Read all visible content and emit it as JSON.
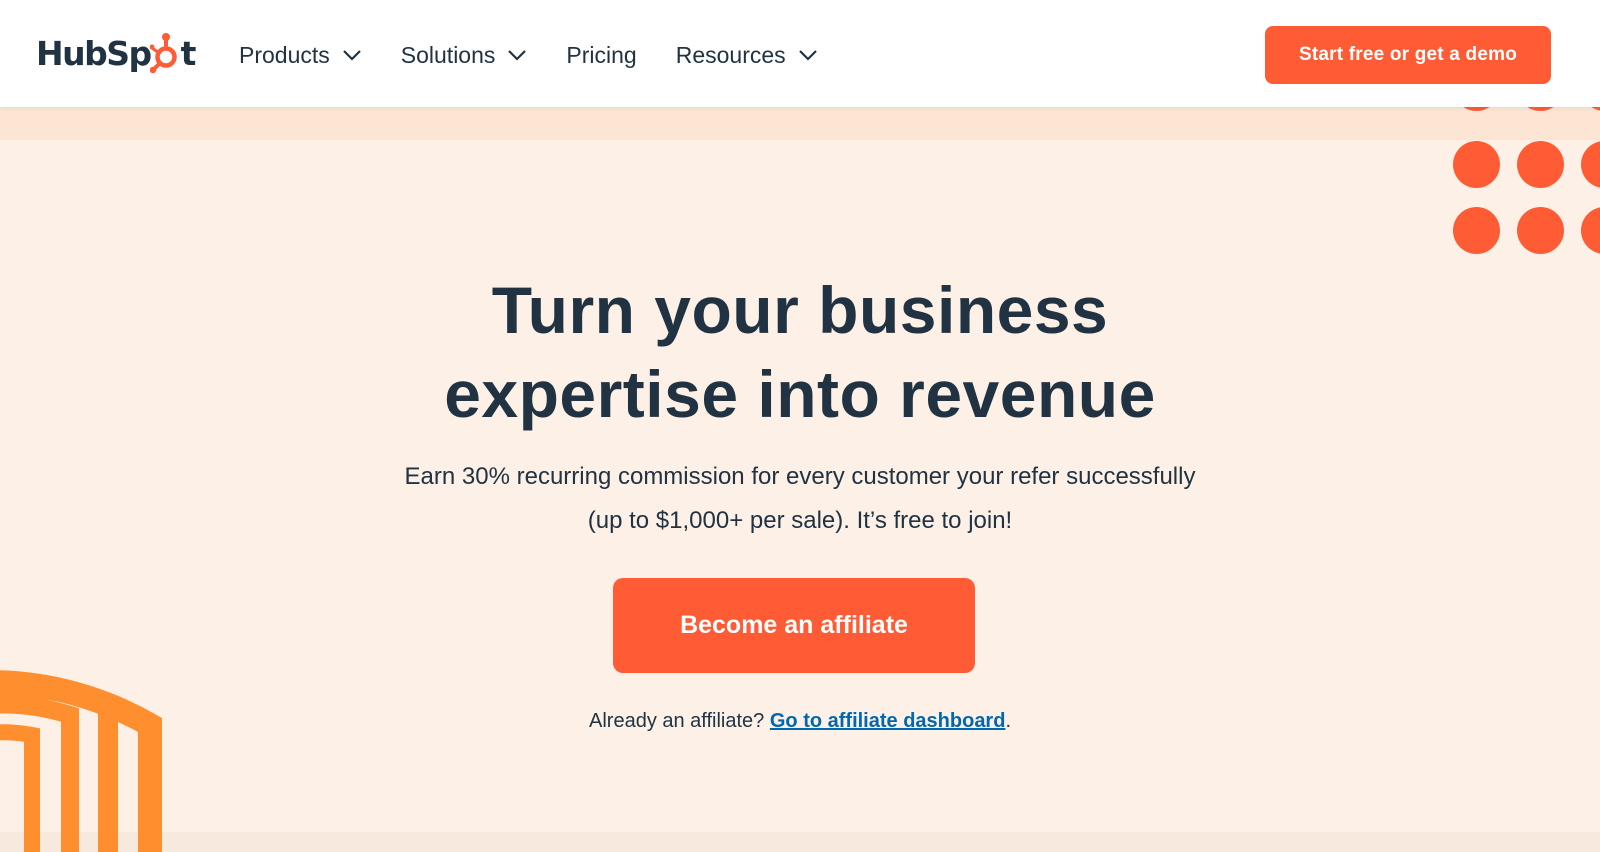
{
  "brand": {
    "logo_text_left": "HubSp",
    "logo_text_right": "t",
    "accent_color": "#ff5c35",
    "dark_color": "#213343",
    "link_color": "#0068b1",
    "background_color": "#fcf0e7",
    "arch_color": "#ff8f2e"
  },
  "nav": {
    "items": [
      {
        "label": "Products",
        "has_dropdown": true
      },
      {
        "label": "Solutions",
        "has_dropdown": true
      },
      {
        "label": "Pricing",
        "has_dropdown": false
      },
      {
        "label": "Resources",
        "has_dropdown": true
      }
    ],
    "cta_label": "Start free or get a demo"
  },
  "hero": {
    "title_line1": "Turn your business",
    "title_line2": "expertise into revenue",
    "subtitle_line1": "Earn 30% recurring commission for every customer your refer successfully",
    "subtitle_line2": "(up to $1,000+ per sale). It’s free to join!",
    "cta_label": "Become an affiliate",
    "already_text": "Already an affiliate? ",
    "dashboard_link": "Go to affiliate dashboard",
    "trailing_period": "."
  },
  "icons": {
    "logo_mark": "sprocket-icon",
    "dropdown": "chevron-down-icon"
  }
}
